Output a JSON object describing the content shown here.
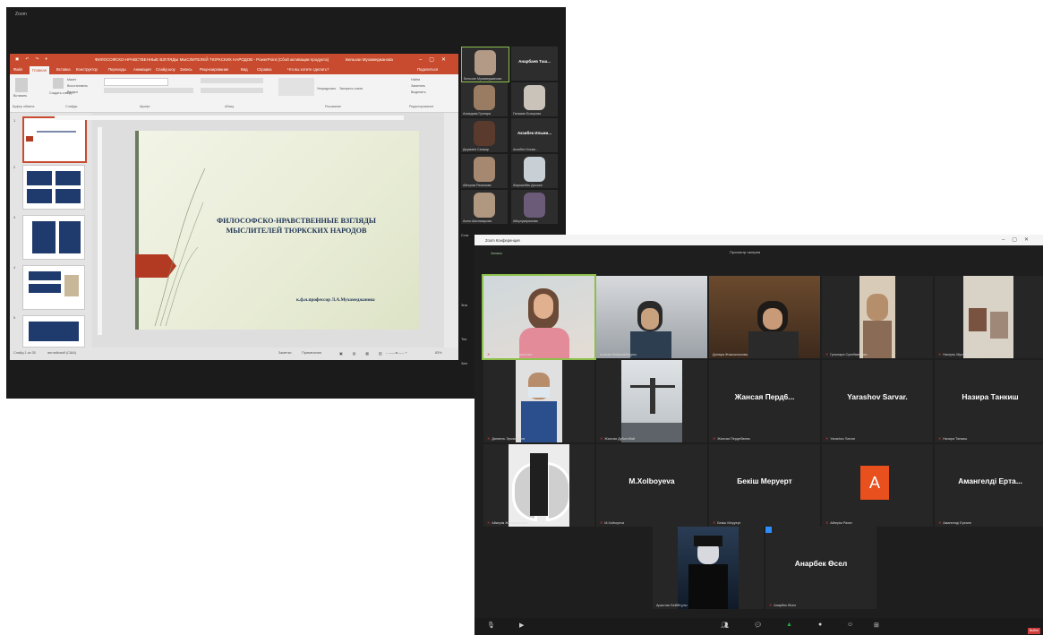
{
  "win1": {
    "title": "Zoom",
    "ppt": {
      "doc_title": "ФИЛОСОФСКО-НРАВСТВЕННЫЕ ВЗГЛЯДЫ МЫСЛИТЕЛЕЙ ТЮРКСКИХ НАРОДОВ - PowerPoint (Сбой активации продукта)",
      "user": "Бельхан Мухамеджанова",
      "tabs": [
        "Файл",
        "Главная",
        "Вставка",
        "Конструктор",
        "Переходы",
        "Анимация",
        "Слайд-шоу",
        "Запись",
        "Рецензирование",
        "Вид",
        "Справка",
        "Что вы хотите сделать?",
        "Поделиться"
      ],
      "active_tab": "Главная",
      "ribbon_groups": [
        "Буфер обмена",
        "Слайды",
        "Шрифт",
        "Абзац",
        "Рисование",
        "Редактирование"
      ],
      "ribbon_buttons": [
        "Вставить",
        "Создать слайд",
        "Макет",
        "Восстановить",
        "Раздел",
        "Упорядочить",
        "Экспресс-стили",
        "Найти",
        "Заменить",
        "Выделить"
      ],
      "thumb_numbers": [
        "1",
        "2",
        "3",
        "4",
        "5"
      ],
      "slide": {
        "title_line1": "ФИЛОСОФСКО-НРАВСТВЕННЫЕ ВЗГЛЯДЫ",
        "title_line2": "МЫСЛИТЕЛЕЙ ТЮРКСКИХ НАРОДОВ",
        "author": "к.ф.н.профессор Л.А.Мухамеджанова"
      },
      "status": {
        "slide_info": "Слайд 1 из 35",
        "language": "английский (США)",
        "notes": "Заметки",
        "comments": "Примечания",
        "zoom": "83%"
      }
    },
    "sidebar": {
      "tiles": [
        {
          "name": "Бельхан Мухамеджанова",
          "big": ""
        },
        {
          "name": "Анарбаев Таш...",
          "big": "Ахмедова Тил..."
        },
        {
          "name": "Ахмедова Гулнара",
          "big": ""
        },
        {
          "name": "Гюльван Бозорова",
          "big": ""
        },
        {
          "name": "Джумаев Санжар",
          "big": ""
        },
        {
          "name": "Акзибек Ильми...",
          "big": "Акзибек Ильми..."
        },
        {
          "name": "Айгерим Рахимова",
          "big": ""
        },
        {
          "name": "Жаркынбек Досжан",
          "big": ""
        },
        {
          "name": "Асем Шахназарова",
          "big": ""
        },
        {
          "name": "Айкулукаримова",
          "big": ""
        }
      ],
      "left_labels": [
        "Стат",
        "Зна",
        "Тек",
        "Зал"
      ]
    }
  },
  "win2": {
    "title": "Zoom Конференция",
    "header_info": "Запись",
    "header_center": "Просмотр галереи",
    "tiles": [
      {
        "label": "Бельхан Мухамеджанова",
        "big": ""
      },
      {
        "label": "Алихан Мейрамбекұлы",
        "big": ""
      },
      {
        "label": "Динара Жаксылыкова",
        "big": ""
      },
      {
        "label": "Гульнара Сулейменова",
        "big": ""
      },
      {
        "label": "Назгуль Мухтарбаева",
        "big": ""
      },
      {
        "label": "Даниель Эрмишбаев",
        "big": ""
      },
      {
        "label": "Жансая Дүйсенбай",
        "big": ""
      },
      {
        "label": "Жансая Пердебаева",
        "big": "Жансая Перд6..."
      },
      {
        "label": "Yarashov Sarvar",
        "big": "Yarashov Sarvar."
      },
      {
        "label": "Назира Танкиш",
        "big": "Назира Танкиш"
      },
      {
        "label": "Айкерім Жаксылыкова",
        "big": ""
      },
      {
        "label": "M.Xolboyeva",
        "big": "M.Xolboyeva"
      },
      {
        "label": "Бекіш Меруерт",
        "big": "Бекіш Меруерт"
      },
      {
        "label": "Айгерім Рахат",
        "big": ""
      },
      {
        "label": "Амангелді Ертаев",
        "big": "Амангелді Ерта..."
      },
      {
        "label": "Арыстан Бейбітұлы",
        "big": ""
      },
      {
        "label": "Анарбек Өсел",
        "big": "Анарбек Өсел"
      }
    ],
    "avatar_letter": "A",
    "toolbar_icons": [
      "mic-icon",
      "video-icon",
      "participants-icon",
      "chat-icon",
      "share-icon",
      "record-icon",
      "reactions-icon",
      "apps-icon"
    ],
    "end_label": "Выйти",
    "colors": {
      "active_border": "#8cbf4a",
      "share": "#1faa3f",
      "end": "#d13c3c",
      "avatar": "#e8501e"
    }
  }
}
